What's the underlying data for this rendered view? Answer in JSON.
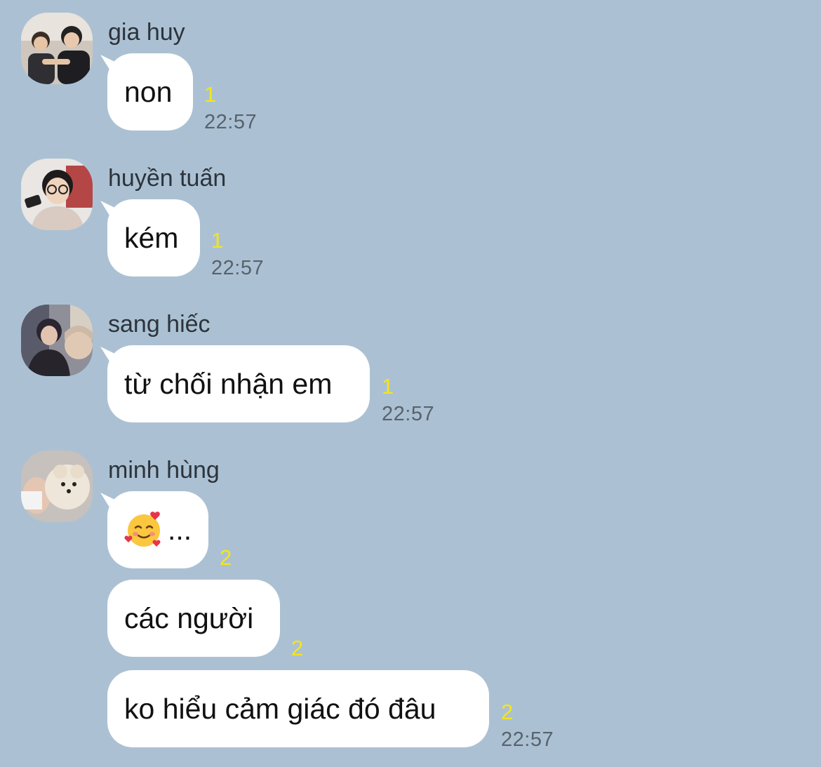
{
  "messages": [
    {
      "sender": "gia huy",
      "avatar_icon": "avatar-gia-huy-icon",
      "bubbles": [
        {
          "text": "non",
          "unread": "1",
          "time": "22:57"
        }
      ]
    },
    {
      "sender": "huyền tuấn",
      "avatar_icon": "avatar-huyen-tuan-icon",
      "bubbles": [
        {
          "text": "kém",
          "unread": "1",
          "time": "22:57"
        }
      ]
    },
    {
      "sender": "sang hiếc",
      "avatar_icon": "avatar-sang-hiec-icon",
      "bubbles": [
        {
          "text": "từ chối nhận em",
          "unread": "1",
          "time": "22:57"
        }
      ]
    },
    {
      "sender": "minh hùng",
      "avatar_icon": "avatar-minh-hung-icon",
      "bubbles": [
        {
          "text": "...",
          "emoji": "smiling-face-with-hearts-icon",
          "unread": "2"
        },
        {
          "text": "các người",
          "unread": "2"
        },
        {
          "text": "ko hiểu cảm giác đó đâu",
          "unread": "2",
          "time": "22:57"
        }
      ]
    }
  ],
  "colors": {
    "background": "#abc1d3",
    "bubble": "#ffffff",
    "unread": "#f4e51a",
    "time": "#58626c",
    "sender": "#2c333b"
  }
}
